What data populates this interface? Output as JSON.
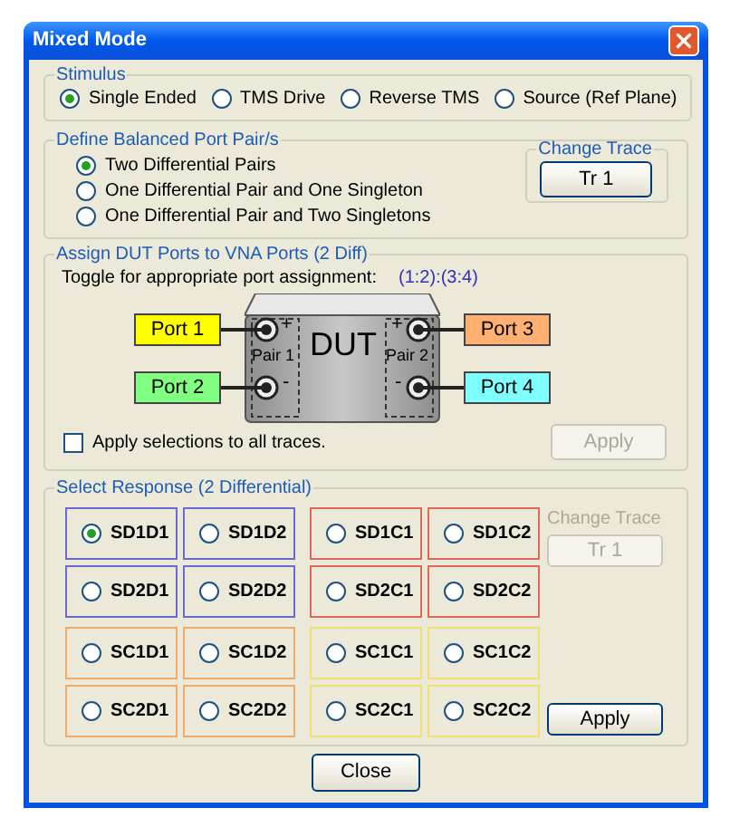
{
  "window": {
    "title": "Mixed Mode"
  },
  "stimulus": {
    "title": "Stimulus",
    "options": [
      {
        "label": "Single Ended",
        "selected": true
      },
      {
        "label": "TMS Drive",
        "selected": false
      },
      {
        "label": "Reverse TMS",
        "selected": false
      },
      {
        "label": "Source (Ref Plane)",
        "selected": false
      }
    ]
  },
  "balanced_pairs": {
    "title": "Define Balanced Port Pair/s",
    "options": [
      {
        "label": "Two Differential Pairs",
        "selected": true
      },
      {
        "label": "One Differential Pair and One Singleton",
        "selected": false
      },
      {
        "label": "One Differential Pair and Two Singletons",
        "selected": false
      }
    ],
    "change_trace": {
      "title": "Change Trace",
      "button": "Tr 1",
      "disabled": false
    }
  },
  "assign": {
    "title": "Assign DUT Ports to VNA Ports (2 Diff)",
    "instruction": "Toggle for appropriate port assignment:",
    "assignment": "(1:2):(3:4)",
    "diagram": {
      "device": "DUT",
      "pairs": [
        {
          "label": "Pair 1",
          "plus": "+",
          "minus": "-"
        },
        {
          "label": "Pair 2",
          "plus": "+",
          "minus": "-"
        }
      ],
      "ports": [
        {
          "label": "Port 1",
          "color": "#ffff00"
        },
        {
          "label": "Port 2",
          "color": "#80ff80"
        },
        {
          "label": "Port 3",
          "color": "#ffb070"
        },
        {
          "label": "Port 4",
          "color": "#80ffff"
        }
      ]
    },
    "apply_all": {
      "label": "Apply selections to all traces.",
      "checked": false
    },
    "apply": {
      "label": "Apply",
      "disabled": true
    }
  },
  "response": {
    "title": "Select Response (2 Differential)",
    "groups": [
      {
        "color": "#6a6ad0",
        "cells": [
          {
            "label": "SD1D1",
            "selected": true
          },
          {
            "label": "SD1D2",
            "selected": false
          },
          {
            "label": "SD2D1",
            "selected": false
          },
          {
            "label": "SD2D2",
            "selected": false
          }
        ]
      },
      {
        "color": "#e06a5a",
        "cells": [
          {
            "label": "SD1C1",
            "selected": false
          },
          {
            "label": "SD1C2",
            "selected": false
          },
          {
            "label": "SD2C1",
            "selected": false
          },
          {
            "label": "SD2C2",
            "selected": false
          }
        ]
      },
      {
        "color": "#f0aa6a",
        "cells": [
          {
            "label": "SC1D1",
            "selected": false
          },
          {
            "label": "SC1D2",
            "selected": false
          },
          {
            "label": "SC2D1",
            "selected": false
          },
          {
            "label": "SC2D2",
            "selected": false
          }
        ]
      },
      {
        "color": "#f0e070",
        "cells": [
          {
            "label": "SC1C1",
            "selected": false
          },
          {
            "label": "SC1C2",
            "selected": false
          },
          {
            "label": "SC2C1",
            "selected": false
          },
          {
            "label": "SC2C2",
            "selected": false
          }
        ]
      }
    ],
    "change_trace": {
      "title": "Change Trace",
      "button": "Tr 1",
      "disabled": true
    },
    "apply": {
      "label": "Apply",
      "disabled": false
    }
  },
  "close": {
    "label": "Close"
  }
}
